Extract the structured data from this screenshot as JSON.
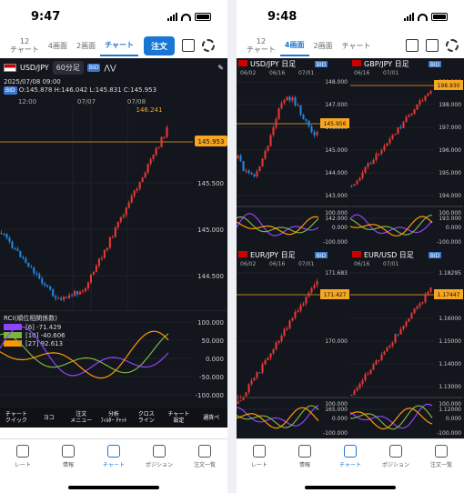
{
  "left": {
    "time": "9:47",
    "tabs": [
      "12\nチャート",
      "4画面",
      "2画面",
      "チャート"
    ],
    "order": "注文",
    "pair": "USD/JPY",
    "interval": "60分足",
    "side": "BID",
    "ohlc_line1": "2025/07/08 09:00",
    "ohlc_line2": "O:145.878 H:146.042 L:145.831 C:145.953",
    "times": [
      "12:00",
      "07/07",
      "07/08"
    ],
    "prices": [
      "145.500",
      "145.000",
      "144.500"
    ],
    "current": "145.953",
    "high_label": "146.241",
    "rsi_title": "RCI(順位相関係数)",
    "rsi": [
      "[6] -71.429",
      "[10] -40.606",
      "[27] 92.613"
    ],
    "rsi_axis": [
      "100.000",
      "50.000",
      "0.000",
      "-50.000",
      "-100.000"
    ],
    "tools": [
      "チャート\nクイック",
      "ヨコ",
      "注文\nメニュー",
      "分析\nﾌｨﾙﾀｰ ﾁｬｯﾄ",
      "クロス\nライン",
      "チャート\n設定",
      "通貨ペ"
    ]
  },
  "right": {
    "time": "9:48",
    "tabs": [
      "12\nチャート",
      "4画面",
      "2画面",
      "チャート"
    ],
    "panels": [
      {
        "pair": "USD/JPY",
        "tf": "日足",
        "side": "BID",
        "dates": [
          "06/02",
          "06/16",
          "07/01"
        ],
        "prices": [
          "148.000",
          "147.000",
          "146.000",
          "145.000",
          "144.000",
          "143.000",
          "142.000"
        ],
        "current": "145.956"
      },
      {
        "pair": "GBP/JPY",
        "tf": "日足",
        "side": "BID",
        "dates": [
          "06/16",
          "07/01"
        ],
        "prices": [
          "199.000",
          "198.000",
          "197.000",
          "196.000",
          "195.000",
          "194.000",
          "193.000"
        ],
        "current": "198.930"
      },
      {
        "pair": "EUR/JPY",
        "tf": "日足",
        "side": "BID",
        "dates": [
          "06/02",
          "06/16",
          "07/01"
        ],
        "prices": [
          "171.683",
          "170.000",
          "165.000"
        ],
        "current": "171.427"
      },
      {
        "pair": "EUR/USD",
        "tf": "日足",
        "side": "BID",
        "dates": [
          "06/16",
          "07/01"
        ],
        "prices": [
          "1.18295",
          "1.17000",
          "1.16000",
          "1.15000",
          "1.14000",
          "1.13000",
          "1.12000"
        ],
        "current": "1.17447"
      }
    ],
    "rsi_axis": [
      "100.000",
      "0.000",
      "-100.000"
    ]
  },
  "nav": [
    "レート",
    "情報",
    "チャート",
    "ポジション",
    "注文一覧"
  ]
}
